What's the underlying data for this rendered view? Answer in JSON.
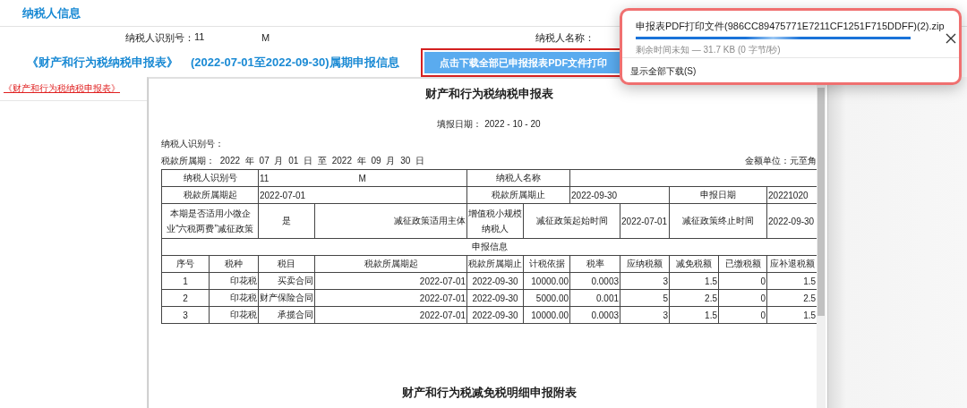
{
  "section_title": "纳税人信息",
  "taxpayer": {
    "id_label": "纳税人识别号：",
    "id_prefix": "11",
    "id_suffix": "M",
    "name_label": "纳税人名称："
  },
  "period_header": {
    "form_title": "《财产和行为税纳税申报表》",
    "period": "(2022-07-01至2022-09-30)属期申报信息",
    "download_button": "点击下载全部已申报报表PDF文件打印"
  },
  "sidebar": {
    "items": [
      {
        "label": "《财产和行为税纳税申报表》",
        "selected": true
      }
    ]
  },
  "document": {
    "title": "财产和行为税纳税申报表",
    "fill_date_label": "填报日期：",
    "fill_date": "2022 - 10 - 20",
    "id_label": "纳税人识别号：",
    "period_line": "税款所属期： 2022 年 07 月 01 日 至 2022 年 09 月 30 日",
    "unit": "金额单位：元至角",
    "info": {
      "id_label": "纳税人识别号",
      "id_prefix": "11",
      "id_suffix": "M",
      "name_label": "纳税人名称",
      "start_label": "税款所属期起",
      "start": "2022-07-01",
      "end_label": "税款所属期止",
      "end": "2022-09-30",
      "filed_label": "申报日期",
      "filed": "20221020",
      "sme_label": "本期是否适用小微企业“六税两费”减征政策",
      "sme_value": "是",
      "subject_label": "减征政策适用主体",
      "subject": "增值税小规模纳税人",
      "policy_start_label": "减征政策起始时间",
      "policy_start": "2022-07-01",
      "policy_end_label": "减征政策终止时间",
      "policy_end": "2022-09-30"
    },
    "section_label": "申报信息",
    "columns": [
      "序号",
      "税种",
      "税目",
      "税款所属期起",
      "税款所属期止",
      "计税依据",
      "税率",
      "应纳税额",
      "减免税额",
      "已缴税额",
      "应补退税额"
    ],
    "rows": [
      [
        "1",
        "印花税",
        "买卖合同",
        "2022-07-01",
        "2022-09-30",
        "10000.00",
        "0.0003",
        "3",
        "1.5",
        "0",
        "1.5"
      ],
      [
        "2",
        "印花税",
        "财产保险合同",
        "2022-07-01",
        "2022-09-30",
        "5000.00",
        "0.001",
        "5",
        "2.5",
        "0",
        "2.5"
      ],
      [
        "3",
        "印花税",
        "承揽合同",
        "2022-07-01",
        "2022-09-30",
        "10000.00",
        "0.0003",
        "3",
        "1.5",
        "0",
        "1.5"
      ]
    ],
    "appendix_title": "财产和行为税减免税明细申报附表"
  },
  "download_popup": {
    "file_name": "申报表PDF打印文件(986CC89475771E7211CF1251F715DDFF)(2).zip",
    "level": 1.0,
    "status": "剩余时间未知 — 31.7 KB (0 字节/秒)",
    "show_all": "显示全部下载(S)"
  }
}
